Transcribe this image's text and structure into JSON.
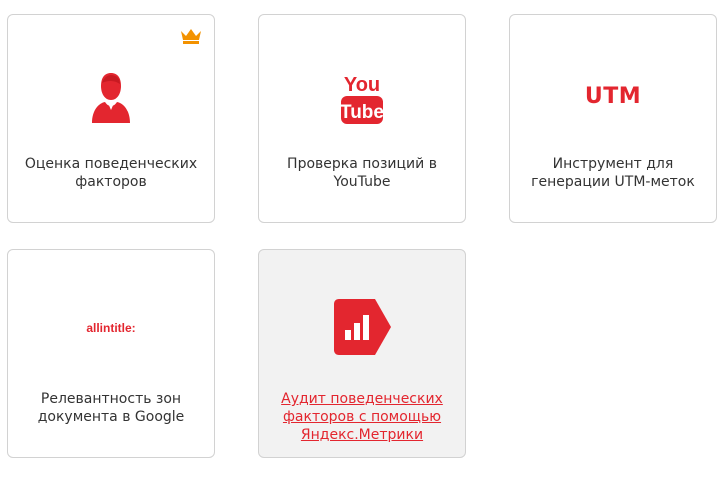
{
  "accent_color": "#e3262f",
  "crown_color": "#f39200",
  "cards": [
    {
      "label": "Оценка поведенческих факторов",
      "icon": "user-icon",
      "premium_icon": "crown-icon"
    },
    {
      "label": "Проверка позиций в YouTube",
      "icon": "youtube-logo",
      "logo_top": "You",
      "logo_bottom": "Tube"
    },
    {
      "label": "Инструмент для генерации UTM-меток",
      "icon": "utm-logo",
      "logo_text": "UTM"
    },
    {
      "label": "Релевантность зон документа в Google",
      "icon": "allintitle-logo",
      "logo_text": "allintitle:"
    },
    {
      "label": "Аудит поведенческих факторов с помощью Яндекс.Метрики",
      "icon": "yandex-metrica-icon",
      "state": "hovered"
    }
  ]
}
